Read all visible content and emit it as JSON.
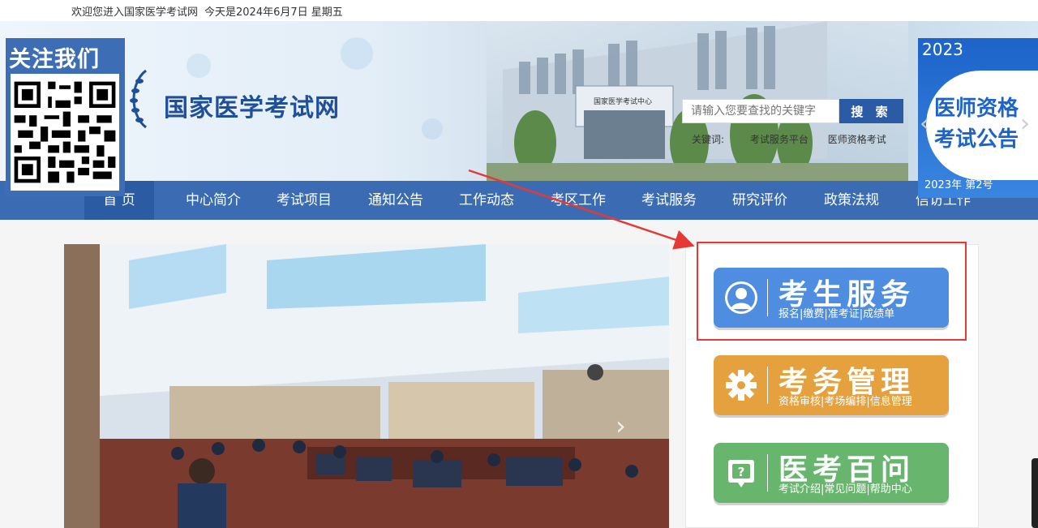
{
  "topbar": {
    "greeting": "欢迎您进入国家医学考试网",
    "date": "今天是2024年6月7日 星期五"
  },
  "site": {
    "name": "国家医学考试网",
    "building_sign": "国家医学考试中心"
  },
  "follow": {
    "title": "关注我们"
  },
  "search": {
    "placeholder": "请输入您要查找的关键字",
    "button": "搜 索",
    "keywords_label": "关键词:",
    "keywords": [
      "考试服务平台",
      "医师资格考试"
    ]
  },
  "exam_ad": {
    "year": "2023",
    "line1": "医师资格",
    "line2": "考试公告",
    "issue": "2023年 第2号"
  },
  "nav": {
    "items": [
      "首 页",
      "中心简介",
      "考试项目",
      "通知公告",
      "工作动态",
      "考区工作",
      "考试服务",
      "研究评价",
      "政策法规",
      "信访工作"
    ]
  },
  "cards": [
    {
      "title": "考生服务",
      "sub": "报名|缴费|准考证|成绩单",
      "color": "#4f8de0",
      "icon": "user-icon"
    },
    {
      "title": "考务管理",
      "sub": "资格审核|考场编排|信息管理",
      "color": "#e6a13f",
      "icon": "gear-icon"
    },
    {
      "title": "医考百问",
      "sub": "考试介绍|常见问题|帮助中心",
      "color": "#68b66e",
      "icon": "question-icon"
    }
  ],
  "colors": {
    "nav": "#3b6cb3",
    "accent": "#2c5ba6",
    "highlight": "#e53935"
  }
}
